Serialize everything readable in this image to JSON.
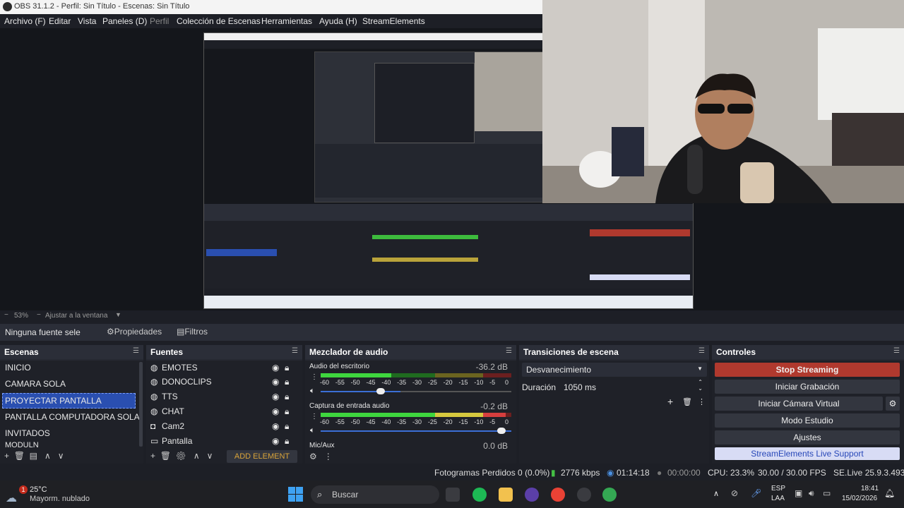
{
  "window": {
    "title": "OBS 31.1.2 - Perfil: Sin Título - Escenas: Sin Título"
  },
  "menu": {
    "items": [
      "Archivo (F)",
      "Editar",
      "Vista",
      "Paneles (D)",
      "Perfil",
      "Colección de Escenas",
      "Herramientas",
      "Ayuda (H)",
      "StreamElements"
    ]
  },
  "zoom": {
    "value": "53%",
    "fit_label": "Ajustar a la ventana"
  },
  "source_toolbar": {
    "no_source": "Ninguna fuente sele",
    "properties": "Propiedades",
    "filters": "Filtros"
  },
  "scenes": {
    "title": "Escenas",
    "items": [
      "INICIO",
      "CAMARA SOLA",
      "PROYECTAR PANTALLA",
      "PANTALLA COMPUTADORA SOLA",
      "INVITADOS",
      "MODULN"
    ],
    "selected_index": 2
  },
  "sources": {
    "title": "Fuentes",
    "items": [
      {
        "label": "EMOTES",
        "icon": "globe-icon"
      },
      {
        "label": "DONOCLIPS",
        "icon": "globe-icon"
      },
      {
        "label": "TTS",
        "icon": "globe-icon"
      },
      {
        "label": "CHAT",
        "icon": "globe-icon"
      },
      {
        "label": "Cam2",
        "icon": "camera-icon"
      },
      {
        "label": "Pantalla",
        "icon": "monitor-icon"
      }
    ],
    "add_element": "ADD ELEMENT"
  },
  "mixer": {
    "title": "Mezclador de audio",
    "channels": [
      {
        "name": "Audio del escritorio",
        "db": "-36.2 dB",
        "level": 0.37
      },
      {
        "name": "Captura de entrada audio",
        "db": "-0.2 dB",
        "level": 0.97
      },
      {
        "name": "Mic/Aux",
        "db": "0.0 dB",
        "level": 0
      }
    ],
    "ticks": [
      "-60",
      "-55",
      "-50",
      "-45",
      "-40",
      "-35",
      "-30",
      "-25",
      "-20",
      "-15",
      "-10",
      "-5",
      "0"
    ]
  },
  "transitions": {
    "title": "Transiciones de escena",
    "selected": "Desvanecimiento",
    "duration_label": "Duración",
    "duration_value": "1050 ms"
  },
  "controls": {
    "title": "Controles",
    "stop_streaming": "Stop Streaming",
    "start_recording": "Iniciar Grabación",
    "start_virtualcam": "Iniciar Cámara Virtual",
    "studio_mode": "Modo Estudio",
    "settings": "Ajustes",
    "live_support": "StreamElements Live Support",
    "colors": {
      "stop": "#b0392e",
      "support": "#d8dcf5"
    }
  },
  "status": {
    "dropped": "Fotogramas Perdidos 0 (0.0%)",
    "kbps": "2776 kbps",
    "live_time": "01:14:18",
    "rec_time": "00:00:00",
    "cpu": "CPU: 23.3%",
    "fps": "30.00 / 30.00 FPS",
    "se_version": "SE.Live 25.9.3.493"
  },
  "taskbar": {
    "weather_temp": "25°C",
    "weather_desc": "Mayorm. nublado",
    "badge": "1",
    "search": "Buscar",
    "lang1": "ESP",
    "lang2": "LAA",
    "time": "18:41",
    "date": "15/02/2026"
  }
}
